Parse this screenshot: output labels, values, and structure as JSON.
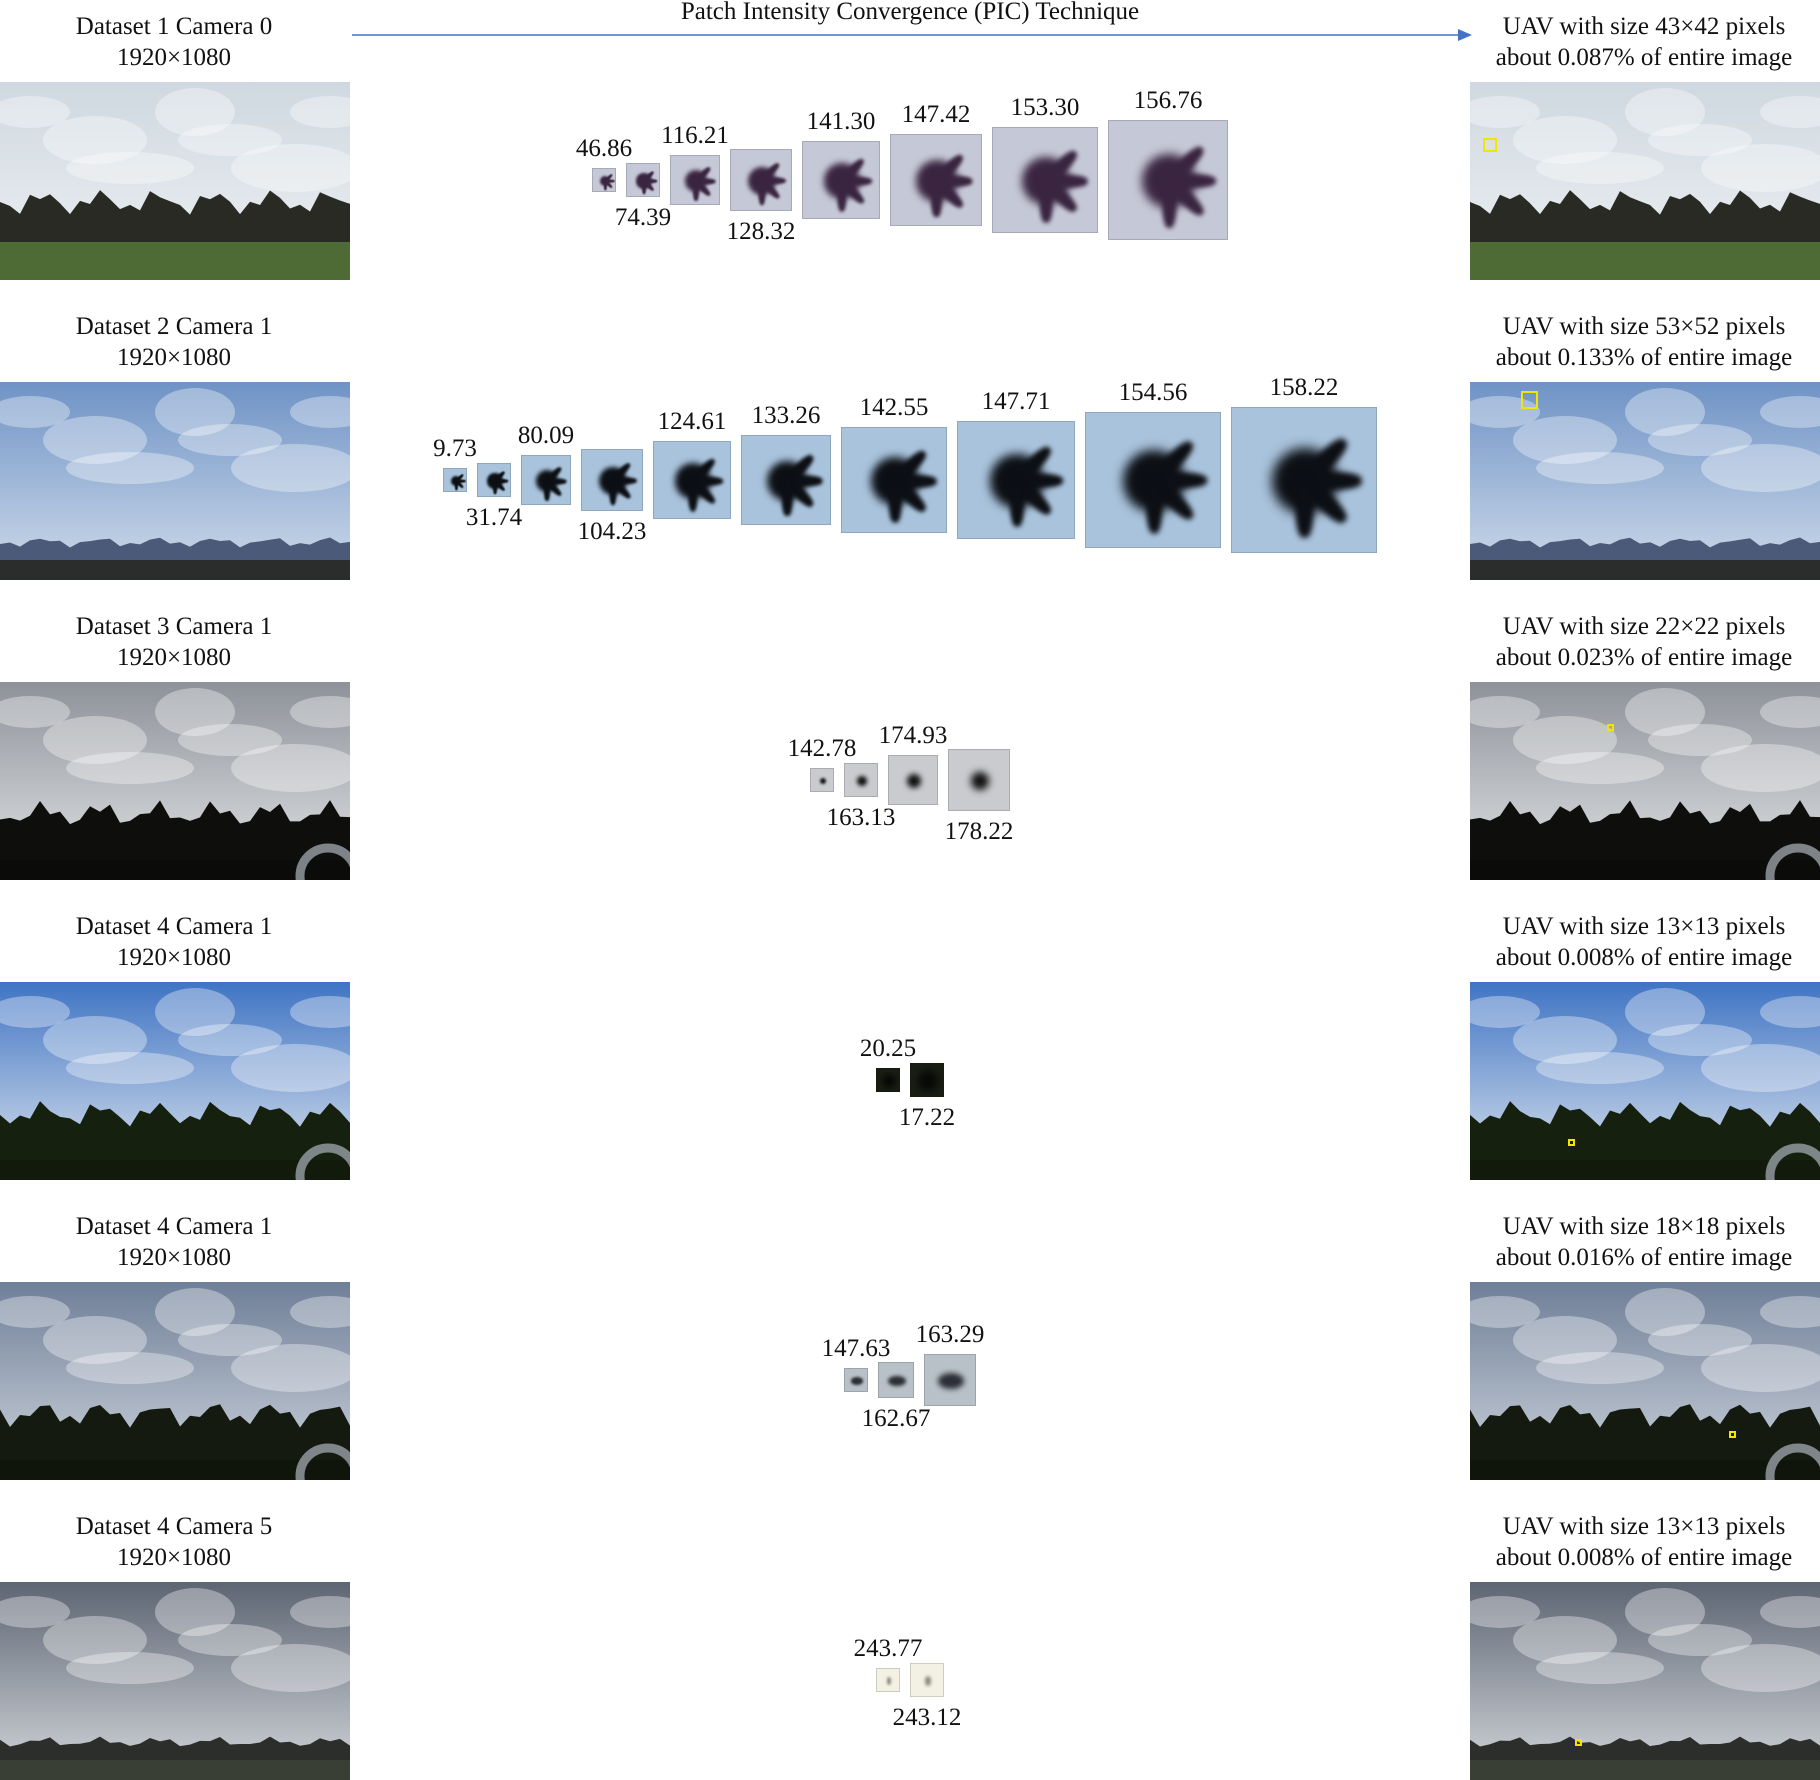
{
  "header": {
    "technique_label": "Patch Intensity Convergence (PIC) Technique",
    "arrow_color": "#4472c4"
  },
  "rows": [
    {
      "source_title": "Dataset 1 Camera 0",
      "source_resolution": "1920×1080",
      "result_line1": "UAV with size 43×42 pixels",
      "result_line2": "about 0.087% of entire image",
      "scene": {
        "sky_top": "#cfd8e0",
        "sky_bottom": "#eef1f3",
        "horizon": "#2a2a24",
        "ground": "#4f6b35",
        "ground_style": "grass",
        "ring": false
      },
      "marker": {
        "x": 0.058,
        "y": 0.32,
        "size": 0.04
      },
      "patch_style": {
        "bg": "#c5c8d6",
        "blob": "#3a2540",
        "shape": "drone"
      },
      "patches": [
        {
          "value": "46.86",
          "label_pos": "above"
        },
        {
          "value": "74.39",
          "label_pos": "below"
        },
        {
          "value": "116.21",
          "label_pos": "above"
        },
        {
          "value": "128.32",
          "label_pos": "below"
        },
        {
          "value": "141.30",
          "label_pos": "above"
        },
        {
          "value": "147.42",
          "label_pos": "above"
        },
        {
          "value": "153.30",
          "label_pos": "above"
        },
        {
          "value": "156.76",
          "label_pos": "above"
        }
      ]
    },
    {
      "source_title": "Dataset 2 Camera 1",
      "source_resolution": "1920×1080",
      "result_line1": "UAV with size 53×52 pixels",
      "result_line2": "about 0.133% of entire image",
      "scene": {
        "sky_top": "#6f93c6",
        "sky_bottom": "#cfdcea",
        "horizon": "#4a5a78",
        "ground": "#2a2d2c",
        "ground_style": "flat",
        "ring": false
      },
      "marker": {
        "x": 0.17,
        "y": 0.09,
        "size": 0.05
      },
      "patch_style": {
        "bg": "#a9c3dc",
        "blob": "#0c0f14",
        "shape": "drone"
      },
      "patches": [
        {
          "value": "9.73",
          "label_pos": "above"
        },
        {
          "value": "31.74",
          "label_pos": "below"
        },
        {
          "value": "80.09",
          "label_pos": "above"
        },
        {
          "value": "104.23",
          "label_pos": "below"
        },
        {
          "value": "124.61",
          "label_pos": "above"
        },
        {
          "value": "133.26",
          "label_pos": "above"
        },
        {
          "value": "142.55",
          "label_pos": "above"
        },
        {
          "value": "147.71",
          "label_pos": "above"
        },
        {
          "value": "154.56",
          "label_pos": "above"
        },
        {
          "value": "158.22",
          "label_pos": "above"
        }
      ]
    },
    {
      "source_title": "Dataset 3 Camera 1",
      "source_resolution": "1920×1080",
      "result_line1": "UAV with size 22×22 pixels",
      "result_line2": "about 0.023% of entire image",
      "scene": {
        "sky_top": "#8e9299",
        "sky_bottom": "#e2e4e6",
        "horizon": "#0e0f0d",
        "ground": "#0b0c0a",
        "ground_style": "trees",
        "ring": true
      },
      "marker": {
        "x": 0.4,
        "y": 0.23,
        "size": 0.02
      },
      "patch_style": {
        "bg": "#c9cbce",
        "blob": "#101010",
        "shape": "dot"
      },
      "patches": [
        {
          "value": "142.78",
          "label_pos": "above"
        },
        {
          "value": "163.13",
          "label_pos": "below"
        },
        {
          "value": "174.93",
          "label_pos": "above"
        },
        {
          "value": "178.22",
          "label_pos": "below"
        }
      ]
    },
    {
      "source_title": "Dataset 4 Camera 1",
      "source_resolution": "1920×1080",
      "result_line1": "UAV with size 13×13 pixels",
      "result_line2": "about 0.008% of entire image",
      "scene": {
        "sky_top": "#3f74c4",
        "sky_bottom": "#dfe6ee",
        "horizon": "#16200f",
        "ground": "#121a0c",
        "ground_style": "trees",
        "ring": true
      },
      "marker": {
        "x": 0.29,
        "y": 0.81,
        "size": 0.015
      },
      "patch_style": {
        "bg": "#1a1f14",
        "blob": "#050505",
        "shape": "dark"
      },
      "patches": [
        {
          "value": "20.25",
          "label_pos": "above"
        },
        {
          "value": "17.22",
          "label_pos": "below"
        }
      ]
    },
    {
      "source_title": "Dataset 4 Camera 1",
      "source_resolution": "1920×1080",
      "result_line1": "UAV with size 18×18 pixels",
      "result_line2": "about 0.016% of entire image",
      "scene": {
        "sky_top": "#6f7f98",
        "sky_bottom": "#cfd5dd",
        "horizon": "#141a10",
        "ground": "#10150c",
        "ground_style": "trees",
        "ring": true
      },
      "marker": {
        "x": 0.75,
        "y": 0.77,
        "size": 0.015
      },
      "patch_style": {
        "bg": "#b8c0c8",
        "blob": "#2a2f34",
        "shape": "wedge"
      },
      "patches": [
        {
          "value": "147.63",
          "label_pos": "above"
        },
        {
          "value": "162.67",
          "label_pos": "below"
        },
        {
          "value": "163.29",
          "label_pos": "above"
        }
      ]
    },
    {
      "source_title": "Dataset 4 Camera 5",
      "source_resolution": "1920×1080",
      "result_line1": "UAV with size 13×13 pixels",
      "result_line2": "about 0.008% of entire image",
      "scene": {
        "sky_top": "#5d6573",
        "sky_bottom": "#d4d8dc",
        "horizon": "#2b2e2b",
        "ground": "#3a3f36",
        "ground_style": "flat",
        "ring": false
      },
      "marker": {
        "x": 0.31,
        "y": 0.81,
        "size": 0.015
      },
      "patch_style": {
        "bg": "#f2f1e4",
        "blob": "#8c8a78",
        "shape": "faint"
      },
      "patches": [
        {
          "value": "243.77",
          "label_pos": "above"
        },
        {
          "value": "243.12",
          "label_pos": "below"
        }
      ]
    }
  ]
}
